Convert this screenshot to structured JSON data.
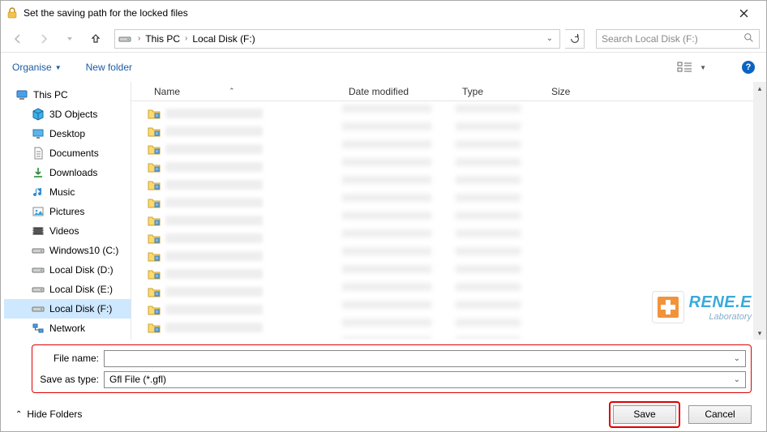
{
  "title": "Set the saving path for the locked files",
  "nav": {
    "breadcrumb": [
      "This PC",
      "Local Disk (F:)"
    ],
    "search_placeholder": "Search Local Disk (F:)"
  },
  "toolbar": {
    "organise": "Organise",
    "newfolder": "New folder"
  },
  "tree": {
    "root": "This PC",
    "items": [
      {
        "label": "3D Objects",
        "icon": "cube"
      },
      {
        "label": "Desktop",
        "icon": "desktop"
      },
      {
        "label": "Documents",
        "icon": "doc"
      },
      {
        "label": "Downloads",
        "icon": "down"
      },
      {
        "label": "Music",
        "icon": "music"
      },
      {
        "label": "Pictures",
        "icon": "pic"
      },
      {
        "label": "Videos",
        "icon": "vid"
      },
      {
        "label": "Windows10 (C:)",
        "icon": "drive"
      },
      {
        "label": "Local Disk (D:)",
        "icon": "drive"
      },
      {
        "label": "Local Disk (E:)",
        "icon": "drive"
      },
      {
        "label": "Local Disk (F:)",
        "icon": "drive",
        "selected": true
      },
      {
        "label": "Network",
        "icon": "net"
      }
    ]
  },
  "columns": {
    "name": "Name",
    "date": "Date modified",
    "type": "Type",
    "size": "Size"
  },
  "form": {
    "filename_label": "File name:",
    "filename_value": "",
    "saveas_label": "Save as type:",
    "saveas_value": "Gfl File (*.gfl)"
  },
  "footer": {
    "hide": "Hide Folders",
    "save": "Save",
    "cancel": "Cancel"
  },
  "watermark": {
    "brand": "RENE.E",
    "sub": "Laboratory"
  },
  "file_row_count": 13
}
